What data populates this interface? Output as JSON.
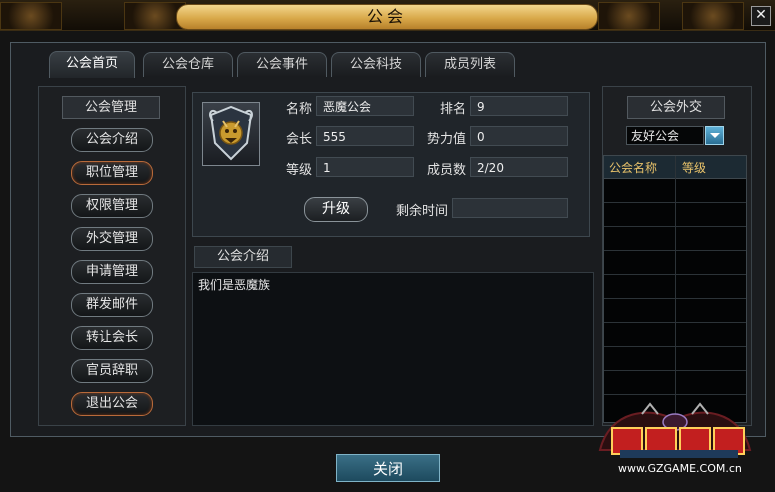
{
  "window": {
    "title": "公会",
    "close_symbol": "✕"
  },
  "tabs": [
    {
      "label": "公会首页",
      "active": true
    },
    {
      "label": "公会仓库"
    },
    {
      "label": "公会事件"
    },
    {
      "label": "公会科技"
    },
    {
      "label": "成员列表"
    }
  ],
  "left_menu": {
    "header": "公会管理",
    "items": [
      "公会介绍",
      "职位管理",
      "权限管理",
      "外交管理",
      "申请管理",
      "群发邮件",
      "转让会长",
      "官员辞职",
      "退出公会"
    ]
  },
  "info": {
    "emblem_icon": "guild-emblem-icon",
    "name_label": "名称",
    "name_value": "恶魔公会",
    "rank_label": "排名",
    "rank_value": "9",
    "leader_label": "会长",
    "leader_value": "555",
    "power_label": "势力值",
    "power_value": "0",
    "level_label": "等级",
    "level_value": "1",
    "members_label": "成员数",
    "members_value": "2/20",
    "upgrade_label": "升级",
    "remaining_label": "剩余时间",
    "remaining_value": ""
  },
  "intro": {
    "header": "公会介绍",
    "text": "我们是恶魔族"
  },
  "diplomacy": {
    "header": "公会外交",
    "dropdown_value": "友好公会",
    "columns": [
      "公会名称",
      "等级"
    ],
    "rows": []
  },
  "bottom": {
    "close_label": "关闭"
  },
  "watermark": {
    "logo_text": "勇士无敌",
    "url": "www.GZGAME.COM.cn"
  }
}
